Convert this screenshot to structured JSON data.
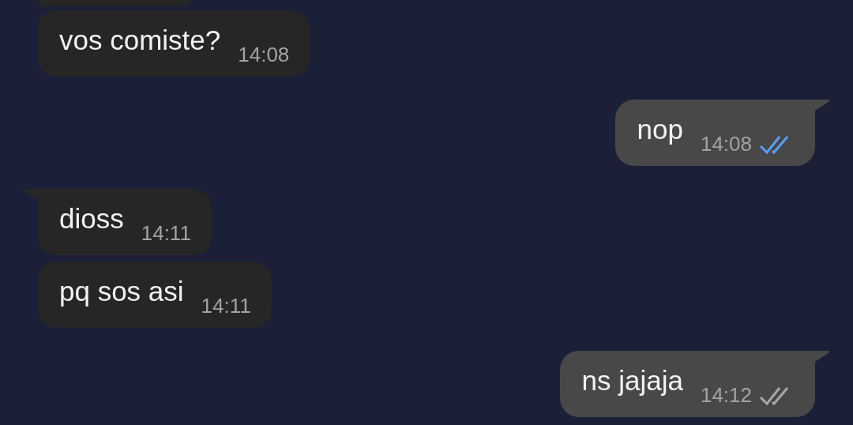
{
  "messages": [
    {
      "kind": "incoming",
      "text": "vos comiste?",
      "time": "14:08",
      "tail": false
    },
    {
      "kind": "outgoing",
      "text": "nop",
      "time": "14:08",
      "tail": true,
      "read": true
    },
    {
      "kind": "incoming",
      "text": "dioss",
      "time": "14:11",
      "tail": true
    },
    {
      "kind": "incoming",
      "text": "pq sos asi",
      "time": "14:11",
      "tail": false
    },
    {
      "kind": "outgoing",
      "text": "ns jajaja",
      "time": "14:12",
      "tail": true,
      "read": false
    }
  ]
}
